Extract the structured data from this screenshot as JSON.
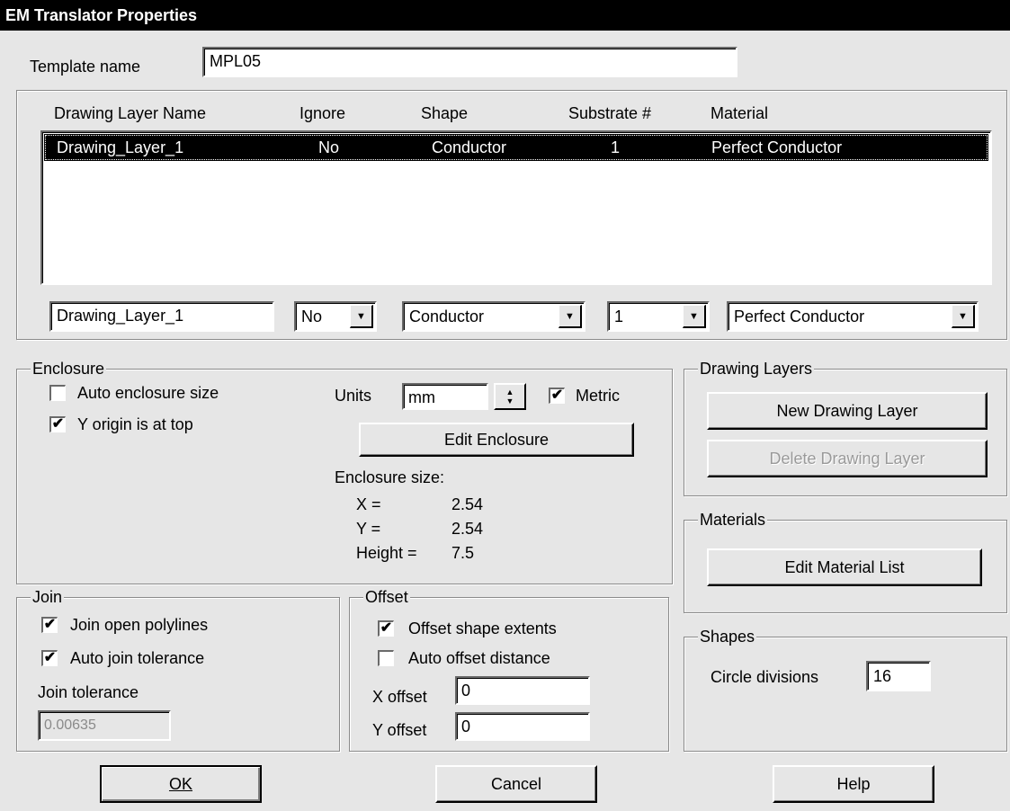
{
  "window": {
    "title": "EM Translator Properties"
  },
  "template": {
    "label": "Template name",
    "value": "MPL05"
  },
  "layers_table": {
    "headers": [
      "Drawing Layer Name",
      "Ignore",
      "Shape",
      "Substrate #",
      "Material"
    ],
    "rows": [
      {
        "name": "Drawing_Layer_1",
        "ignore": "No",
        "shape": "Conductor",
        "substrate": "1",
        "material": "Perfect Conductor"
      }
    ]
  },
  "editors": {
    "name_value": "Drawing_Layer_1",
    "ignore_value": "No",
    "shape_value": "Conductor",
    "substrate_value": "1",
    "material_value": "Perfect Conductor"
  },
  "enclosure": {
    "title": "Enclosure",
    "auto_size_label": "Auto enclosure size",
    "auto_size_checked": false,
    "y_origin_label": "Y origin is at top",
    "y_origin_checked": true,
    "units_label": "Units",
    "units_value": "mm",
    "metric_label": "Metric",
    "metric_checked": true,
    "edit_button": "Edit Enclosure",
    "size_label": "Enclosure size:",
    "x_label": "X =",
    "x_value": "2.54",
    "y_label": "Y =",
    "y_value": "2.54",
    "height_label": "Height =",
    "height_value": "7.5"
  },
  "drawing_layers": {
    "title": "Drawing Layers",
    "new_button": "New Drawing Layer",
    "delete_button": "Delete Drawing Layer"
  },
  "materials": {
    "title": "Materials",
    "edit_button": "Edit Material List"
  },
  "join": {
    "title": "Join",
    "open_polylines_label": "Join open polylines",
    "open_polylines_checked": true,
    "auto_tolerance_label": "Auto join tolerance",
    "auto_tolerance_checked": true,
    "tolerance_label": "Join tolerance",
    "tolerance_value": "0.00635"
  },
  "offset": {
    "title": "Offset",
    "shape_extents_label": "Offset shape extents",
    "shape_extents_checked": true,
    "auto_distance_label": "Auto offset distance",
    "auto_distance_checked": false,
    "x_label": "X offset",
    "x_value": "0",
    "y_label": "Y offset",
    "y_value": "0"
  },
  "shapes": {
    "title": "Shapes",
    "circle_label": "Circle divisions",
    "circle_value": "16"
  },
  "footer": {
    "ok": "OK",
    "cancel": "Cancel",
    "help": "Help"
  },
  "glyphs": {
    "check": "✔",
    "dropdown": "▼",
    "spin_up": "▲",
    "spin_down": "▼"
  }
}
